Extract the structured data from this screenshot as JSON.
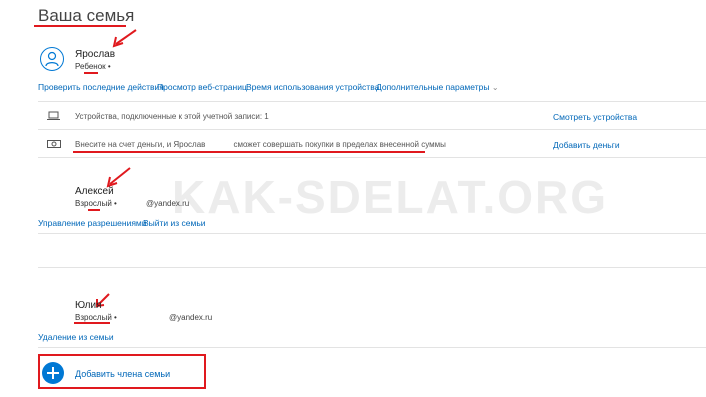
{
  "page": {
    "title": "Ваша семья",
    "watermark": "KAK-SDELAT.ORG"
  },
  "member1": {
    "name": "Ярослав",
    "role": "Ребенок",
    "dot": "•",
    "actions": [
      "Проверить последние действия",
      "Просмотр веб-страниц",
      "Время использования устройства",
      "Дополнительные параметры"
    ],
    "dropdown_arrow": "⌄",
    "devices_text": "Устройства, подключенные к этой учетной записи: 1",
    "devices_link": "Смотреть устройства",
    "money_text_a": "Внесите на счет деньги, и Ярослав",
    "money_text_b": "сможет совершать покупки в пределах внесенной суммы",
    "money_link": "Добавить деньги"
  },
  "member2": {
    "name": "Алексей",
    "role": "Взрослый",
    "dot": "•",
    "email": "@yandex.ru",
    "actions": [
      "Управление разрешениями",
      "Выйти из семьи"
    ]
  },
  "member3": {
    "name": "Юлия",
    "role": "Взрослый",
    "dot": "•",
    "email": "@yandex.ru",
    "actions": [
      "Удаление из семьи"
    ]
  },
  "add_member": {
    "label": "Добавить члена семьи"
  },
  "colors": {
    "accent": "#0078d4",
    "link": "#0067b8",
    "annotation_red": "#e0191e"
  }
}
